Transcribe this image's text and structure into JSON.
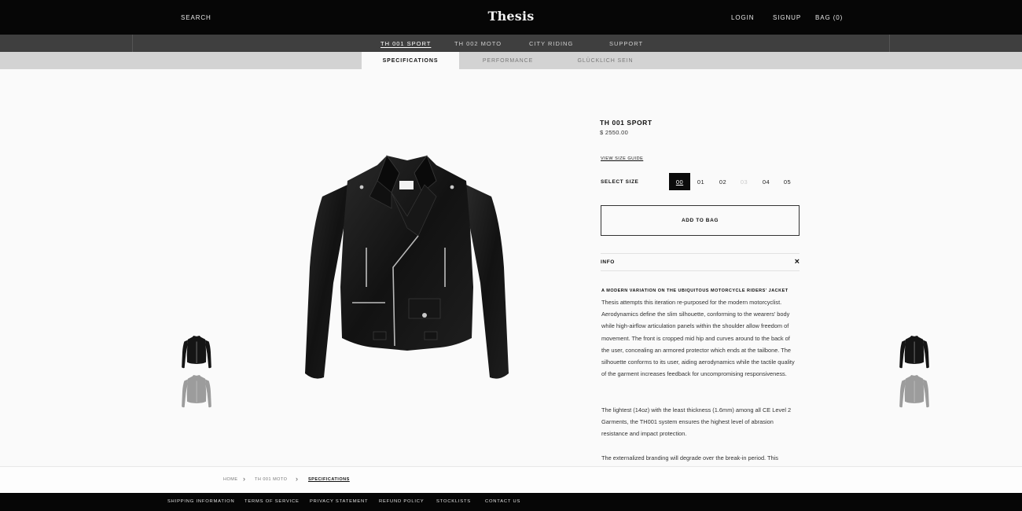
{
  "header": {
    "brand": "Thesis",
    "search_label": "SEARCH",
    "login_label": "LOGIN",
    "signup_label": "SIGNUP",
    "bag_label": "BAG (0)"
  },
  "nav": {
    "items": [
      {
        "label": "TH 001 SPORT",
        "active": true
      },
      {
        "label": "TH 002 MOTO",
        "active": false
      },
      {
        "label": "CITY RIDING",
        "active": false
      },
      {
        "label": "SUPPORT",
        "active": false
      }
    ]
  },
  "subnav": {
    "tabs": [
      {
        "label": "SPECIFICATIONS",
        "active": true
      },
      {
        "label": "PERFORMANCE",
        "active": false
      },
      {
        "label": "GLÜCKLICH SEIN",
        "active": false
      }
    ]
  },
  "product": {
    "title": "TH 001  SPORT",
    "price": "$ 2550.00",
    "size_guide_label": "VIEW SIZE GUIDE",
    "select_size_label": "SELECT SIZE",
    "sizes": [
      {
        "label": "00",
        "state": "selected"
      },
      {
        "label": "01",
        "state": "available"
      },
      {
        "label": "02",
        "state": "available"
      },
      {
        "label": "03",
        "state": "disabled"
      },
      {
        "label": "04",
        "state": "available"
      },
      {
        "label": "05",
        "state": "available"
      }
    ],
    "add_to_bag_label": "ADD TO BAG",
    "info_label": "INFO",
    "info_close": "×",
    "description_heading": "A MODERN VARIATION ON THE UBIQUITOUS MOTORCYCLE RIDERS' JACKET",
    "description_paragraphs": [
      "Thesis attempts this iteration re-purposed for the modern motorcyclist. Aerodynamics define the slim silhouette, conforming to the wearers' body while high-airflow articulation panels within the shoulder allow freedom of movement. The front is cropped mid hip and curves around to the back of the user, concealing an armored protector which ends at the tailbone. The silhouette conforms to its user, aiding aerodynamics while the tactile quality of the garment increases feedback for uncompromising responsiveness.",
      "The lightest (14oz) with the least thickness (1.6mm) among all CE Level 2 Garments, the TH001 system ensures the highest level of abrasion resistance and impact protection.",
      "The externalized branding will degrade over the break-in period. This"
    ]
  },
  "breadcrumb": {
    "items": [
      {
        "label": "HOME"
      },
      {
        "label": "TH 001 MOTO"
      },
      {
        "label": "SPECIFICATIONS"
      }
    ],
    "separator": "›"
  },
  "footer": {
    "links": [
      "SHIPPING INFORMATION",
      "TERMS OF SERVICE",
      "PRIVACY STATEMENT",
      "REFUND POLICY",
      "STOCKLISTS",
      "CONTACT US"
    ]
  },
  "colors": {
    "header_bg": "#060606",
    "nav_bg": "#3f3f3f",
    "subnav_bg": "#d3d3d3",
    "page_bg": "#fafafa",
    "accent": "#0b0b0b"
  },
  "icons": {
    "jacket_black": "jacket-black-image",
    "jacket_grey": "jacket-grey-image"
  }
}
